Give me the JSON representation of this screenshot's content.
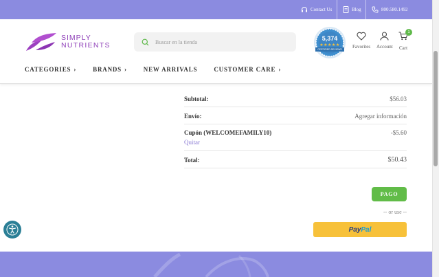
{
  "topbar": {
    "contact_label": "Contact Us",
    "blog_label": "Blog",
    "phone": "800.580.1492"
  },
  "brand": {
    "name_line1": "SIMPLY",
    "name_line2": "NUTRIENTS",
    "color": "#8e3fb8"
  },
  "search": {
    "placeholder": "Buscar en la tienda"
  },
  "reviews_badge": {
    "count": "5,374",
    "caption": "CERTIFIED REVIEWS"
  },
  "header_actions": {
    "favorites_label": "Favorites",
    "account_label": "Account",
    "cart_label": "Cart",
    "cart_count": "1"
  },
  "nav": {
    "items": [
      "CATEGORIES",
      "BRANDS",
      "NEW ARRIVALS",
      "CUSTOMER CARE"
    ]
  },
  "totals": {
    "subtotal_label": "Subtotal:",
    "subtotal_value": "$56.03",
    "shipping_label": "Envío:",
    "shipping_action": "Agregar información",
    "coupon_label": "Cupón (WELCOMEFAMILY10)",
    "coupon_value": "-$5.60",
    "coupon_remove": "Quitar",
    "total_label": "Total:",
    "total_value": "$50.43"
  },
  "checkout": {
    "pay_button": "PAGO",
    "or_use": "-- or use --",
    "paypal_part1": "Pay",
    "paypal_part2": "Pal"
  },
  "colors": {
    "accent_bar": "#8b8be0",
    "pay_green": "#61bc48",
    "paypal_yellow": "#f7c13a",
    "link_purple": "#8b7cd4"
  }
}
